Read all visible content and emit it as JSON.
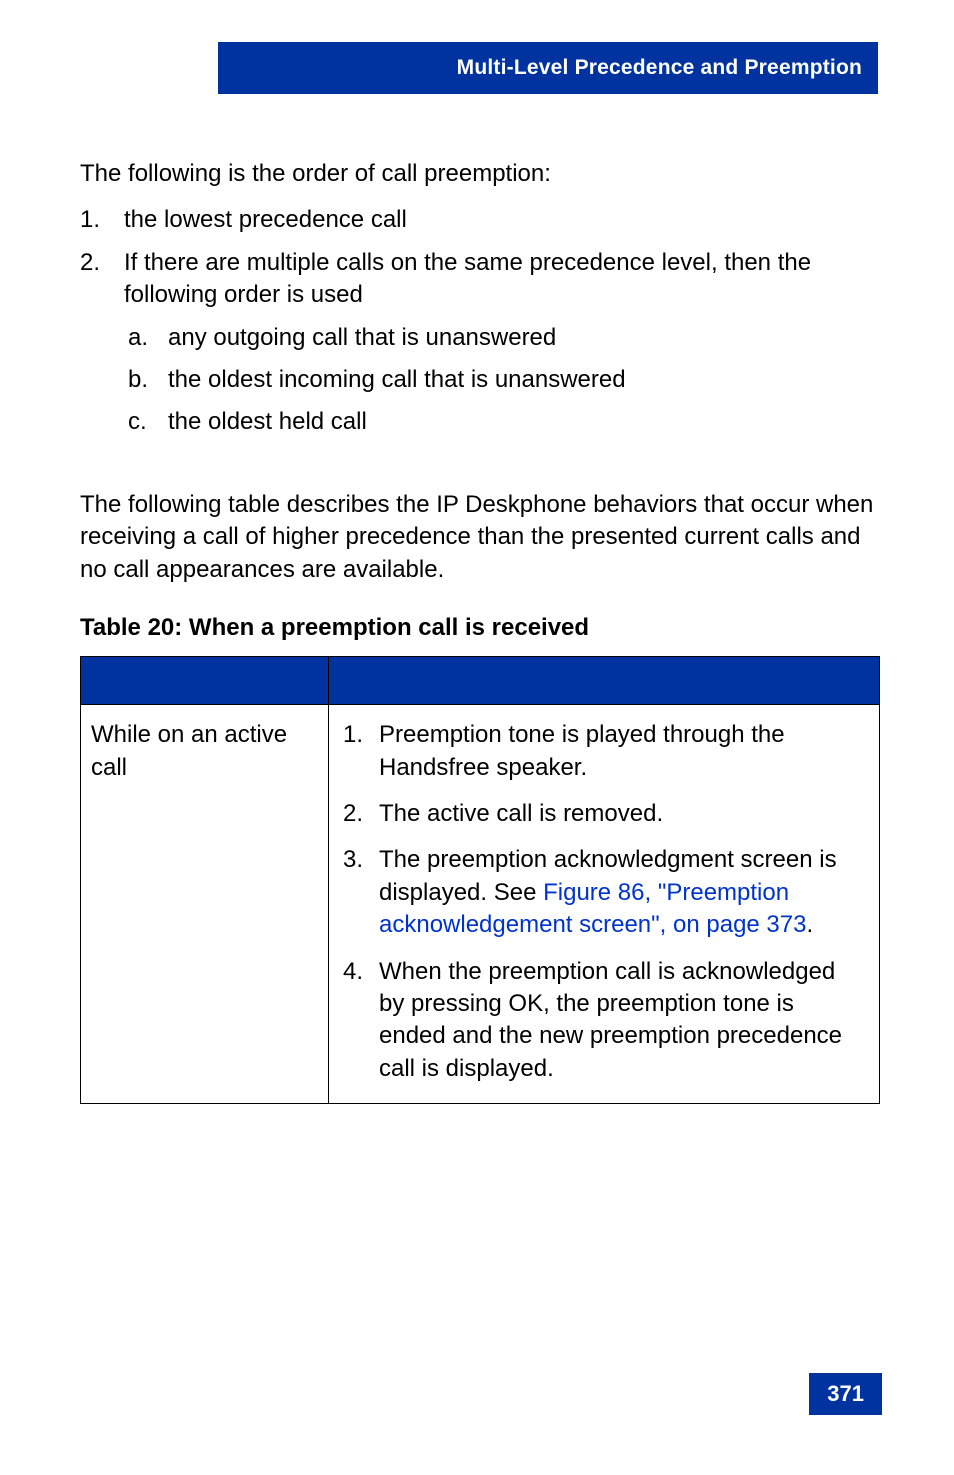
{
  "header": {
    "title": "Multi-Level Precedence and Preemption"
  },
  "intro1": "The following is the order of call preemption:",
  "list_main": [
    {
      "num": "1.",
      "text": "the lowest precedence call"
    },
    {
      "num": "2.",
      "text": "If there are multiple calls on the same precedence level, then the following order is used",
      "sub": [
        {
          "num": "a.",
          "text": "any outgoing call that is unanswered"
        },
        {
          "num": "b.",
          "text": "the oldest incoming call that is unanswered"
        },
        {
          "num": "c.",
          "text": "the oldest held call"
        }
      ]
    }
  ],
  "intro2": "The following table describes the IP Deskphone behaviors that occur when receiving a call of higher precedence than the presented current calls and no call appearances are available.",
  "table_caption": "Table 20: When a preemption call is received",
  "table": {
    "row1_left": "While on an active call",
    "row1_right": [
      {
        "num": "1.",
        "text": "Preemption tone is played through the Handsfree speaker."
      },
      {
        "num": "2.",
        "text": "The active call is removed."
      },
      {
        "num": "3.",
        "text_before": "The preemption acknowledgment screen is displayed. See ",
        "link": "Figure 86, \"Preemption acknowledgement screen\", on page 373",
        "text_after": "."
      },
      {
        "num": "4.",
        "text": "When the preemption call is acknowledged by pressing OK, the preemption tone is ended and the new preemption precedence call is displayed."
      }
    ]
  },
  "page_number": "371"
}
